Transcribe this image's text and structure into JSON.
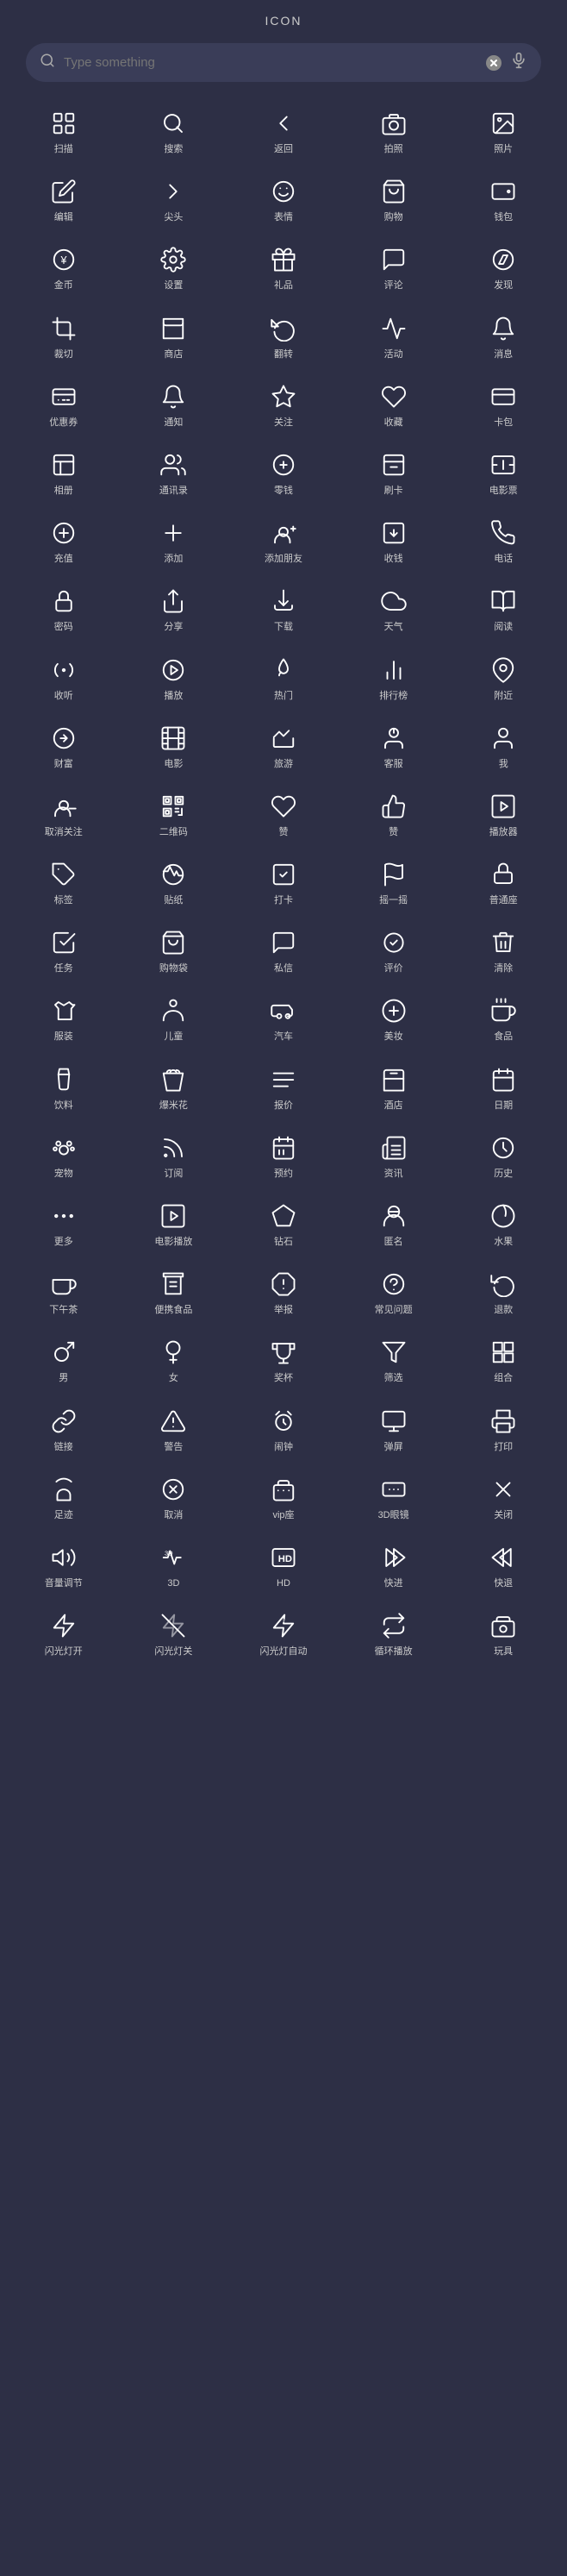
{
  "page": {
    "title": "ICON",
    "search": {
      "placeholder": "Type something"
    }
  },
  "icons": [
    {
      "id": "scan",
      "label": "扫描",
      "symbol": "scan"
    },
    {
      "id": "search",
      "label": "搜索",
      "symbol": "search"
    },
    {
      "id": "back",
      "label": "返回",
      "symbol": "back"
    },
    {
      "id": "camera",
      "label": "拍照",
      "symbol": "camera"
    },
    {
      "id": "photo",
      "label": "照片",
      "symbol": "photo"
    },
    {
      "id": "edit",
      "label": "编辑",
      "symbol": "edit"
    },
    {
      "id": "arrow",
      "label": "尖头",
      "symbol": "arrow"
    },
    {
      "id": "emoji",
      "label": "表情",
      "symbol": "emoji"
    },
    {
      "id": "shop",
      "label": "购物",
      "symbol": "shop"
    },
    {
      "id": "wallet",
      "label": "钱包",
      "symbol": "wallet"
    },
    {
      "id": "coin",
      "label": "金币",
      "symbol": "coin"
    },
    {
      "id": "settings",
      "label": "设置",
      "symbol": "settings"
    },
    {
      "id": "gift",
      "label": "礼品",
      "symbol": "gift"
    },
    {
      "id": "comment",
      "label": "评论",
      "symbol": "comment"
    },
    {
      "id": "discover",
      "label": "发现",
      "symbol": "discover"
    },
    {
      "id": "crop",
      "label": "裁切",
      "symbol": "crop"
    },
    {
      "id": "store",
      "label": "商店",
      "symbol": "store"
    },
    {
      "id": "flip",
      "label": "翻转",
      "symbol": "flip"
    },
    {
      "id": "activity",
      "label": "活动",
      "symbol": "activity"
    },
    {
      "id": "notification",
      "label": "消息",
      "symbol": "notification"
    },
    {
      "id": "coupon",
      "label": "优惠券",
      "symbol": "coupon"
    },
    {
      "id": "notify",
      "label": "通知",
      "symbol": "notify"
    },
    {
      "id": "star",
      "label": "关注",
      "symbol": "star"
    },
    {
      "id": "collect",
      "label": "收藏",
      "symbol": "collect"
    },
    {
      "id": "card",
      "label": "卡包",
      "symbol": "card"
    },
    {
      "id": "album",
      "label": "相册",
      "symbol": "album"
    },
    {
      "id": "contacts",
      "label": "通讯录",
      "symbol": "contacts"
    },
    {
      "id": "change",
      "label": "零钱",
      "symbol": "change"
    },
    {
      "id": "swipe",
      "label": "刷卡",
      "symbol": "swipe"
    },
    {
      "id": "ticket",
      "label": "电影票",
      "symbol": "ticket"
    },
    {
      "id": "recharge",
      "label": "充值",
      "symbol": "recharge"
    },
    {
      "id": "add",
      "label": "添加",
      "symbol": "add"
    },
    {
      "id": "addfriend",
      "label": "添加朋友",
      "symbol": "addfriend"
    },
    {
      "id": "receivemoney",
      "label": "收钱",
      "symbol": "receivemoney"
    },
    {
      "id": "phone",
      "label": "电话",
      "symbol": "phone"
    },
    {
      "id": "password",
      "label": "密码",
      "symbol": "password"
    },
    {
      "id": "share",
      "label": "分享",
      "symbol": "share"
    },
    {
      "id": "download",
      "label": "下载",
      "symbol": "download"
    },
    {
      "id": "weather",
      "label": "天气",
      "symbol": "weather"
    },
    {
      "id": "read",
      "label": "阅读",
      "symbol": "read"
    },
    {
      "id": "listen",
      "label": "收听",
      "symbol": "listen"
    },
    {
      "id": "play",
      "label": "播放",
      "symbol": "play"
    },
    {
      "id": "hot",
      "label": "热门",
      "symbol": "hot"
    },
    {
      "id": "rank",
      "label": "排行榜",
      "symbol": "rank"
    },
    {
      "id": "nearby",
      "label": "附近",
      "symbol": "nearby"
    },
    {
      "id": "wealth",
      "label": "财富",
      "symbol": "wealth"
    },
    {
      "id": "movie",
      "label": "电影",
      "symbol": "movie"
    },
    {
      "id": "travel",
      "label": "旅游",
      "symbol": "travel"
    },
    {
      "id": "service",
      "label": "客服",
      "symbol": "service"
    },
    {
      "id": "me",
      "label": "我",
      "symbol": "me"
    },
    {
      "id": "unfollow",
      "label": "取消关注",
      "symbol": "unfollow"
    },
    {
      "id": "qrcode",
      "label": "二维码",
      "symbol": "qrcode"
    },
    {
      "id": "like",
      "label": "赞",
      "symbol": "like"
    },
    {
      "id": "thumbup",
      "label": "赞",
      "symbol": "thumbup"
    },
    {
      "id": "player",
      "label": "播放器",
      "symbol": "player"
    },
    {
      "id": "tag",
      "label": "标签",
      "symbol": "tag"
    },
    {
      "id": "sticker",
      "label": "贴纸",
      "symbol": "sticker"
    },
    {
      "id": "checkin",
      "label": "打卡",
      "symbol": "checkin"
    },
    {
      "id": "shake",
      "label": "摇一摇",
      "symbol": "shake"
    },
    {
      "id": "putong",
      "label": "普通座",
      "symbol": "putong"
    },
    {
      "id": "task",
      "label": "任务",
      "symbol": "task"
    },
    {
      "id": "bag",
      "label": "购物袋",
      "symbol": "bag"
    },
    {
      "id": "message",
      "label": "私信",
      "symbol": "message"
    },
    {
      "id": "review",
      "label": "评价",
      "symbol": "review"
    },
    {
      "id": "delete",
      "label": "清除",
      "symbol": "delete"
    },
    {
      "id": "clothes",
      "label": "服装",
      "symbol": "clothes"
    },
    {
      "id": "children",
      "label": "儿童",
      "symbol": "children"
    },
    {
      "id": "car",
      "label": "汽车",
      "symbol": "car"
    },
    {
      "id": "beauty",
      "label": "美妆",
      "symbol": "beauty"
    },
    {
      "id": "food",
      "label": "食品",
      "symbol": "food"
    },
    {
      "id": "drink",
      "label": "饮料",
      "symbol": "drink"
    },
    {
      "id": "popcorn",
      "label": "爆米花",
      "symbol": "popcorn"
    },
    {
      "id": "quote",
      "label": "报价",
      "symbol": "quote"
    },
    {
      "id": "hotel",
      "label": "酒店",
      "symbol": "hotel"
    },
    {
      "id": "date",
      "label": "日期",
      "symbol": "date"
    },
    {
      "id": "pet",
      "label": "宠物",
      "symbol": "pet"
    },
    {
      "id": "subscribe",
      "label": "订阅",
      "symbol": "subscribe"
    },
    {
      "id": "reserve",
      "label": "预约",
      "symbol": "reserve"
    },
    {
      "id": "news",
      "label": "资讯",
      "symbol": "news"
    },
    {
      "id": "history",
      "label": "历史",
      "symbol": "history"
    },
    {
      "id": "more",
      "label": "更多",
      "symbol": "more"
    },
    {
      "id": "movieplay",
      "label": "电影播放",
      "symbol": "movieplay"
    },
    {
      "id": "diamond",
      "label": "钻石",
      "symbol": "diamond"
    },
    {
      "id": "anonymous",
      "label": "匿名",
      "symbol": "anonymous"
    },
    {
      "id": "fruit",
      "label": "水果",
      "symbol": "fruit"
    },
    {
      "id": "teatime",
      "label": "下午茶",
      "symbol": "teatime"
    },
    {
      "id": "snack",
      "label": "便携食品",
      "symbol": "snack"
    },
    {
      "id": "report",
      "label": "举报",
      "symbol": "report"
    },
    {
      "id": "faq",
      "label": "常见问题",
      "symbol": "faq"
    },
    {
      "id": "refund",
      "label": "退款",
      "symbol": "refund"
    },
    {
      "id": "male",
      "label": "男",
      "symbol": "male"
    },
    {
      "id": "female",
      "label": "女",
      "symbol": "female"
    },
    {
      "id": "trophy",
      "label": "奖杯",
      "symbol": "trophy"
    },
    {
      "id": "filter",
      "label": "筛选",
      "symbol": "filter"
    },
    {
      "id": "group",
      "label": "组合",
      "symbol": "group"
    },
    {
      "id": "link",
      "label": "链接",
      "symbol": "link"
    },
    {
      "id": "warning",
      "label": "警告",
      "symbol": "warning"
    },
    {
      "id": "alarm",
      "label": "闹钟",
      "symbol": "alarm"
    },
    {
      "id": "screen",
      "label": "弹屏",
      "symbol": "screen"
    },
    {
      "id": "print",
      "label": "打印",
      "symbol": "print"
    },
    {
      "id": "footprint",
      "label": "足迹",
      "symbol": "footprint"
    },
    {
      "id": "cancel",
      "label": "取消",
      "symbol": "cancel"
    },
    {
      "id": "vipseat",
      "label": "vip座",
      "symbol": "vipseat"
    },
    {
      "id": "vr",
      "label": "3D眼镜",
      "symbol": "vr"
    },
    {
      "id": "close",
      "label": "关闭",
      "symbol": "close"
    },
    {
      "id": "volume",
      "label": "音量调节",
      "symbol": "volume"
    },
    {
      "id": "threed",
      "label": "3D",
      "symbol": "threed"
    },
    {
      "id": "hd",
      "label": "HD",
      "symbol": "hd"
    },
    {
      "id": "fastforward",
      "label": "快进",
      "symbol": "fastforward"
    },
    {
      "id": "rewind",
      "label": "快退",
      "symbol": "rewind"
    },
    {
      "id": "flashon",
      "label": "闪光灯开",
      "symbol": "flashon"
    },
    {
      "id": "flashoff",
      "label": "闪光灯关",
      "symbol": "flashoff"
    },
    {
      "id": "flashauto",
      "label": "闪光灯自动",
      "symbol": "flashauto"
    },
    {
      "id": "loop",
      "label": "循环播放",
      "symbol": "loop"
    },
    {
      "id": "toy",
      "label": "玩具",
      "symbol": "toy"
    }
  ]
}
